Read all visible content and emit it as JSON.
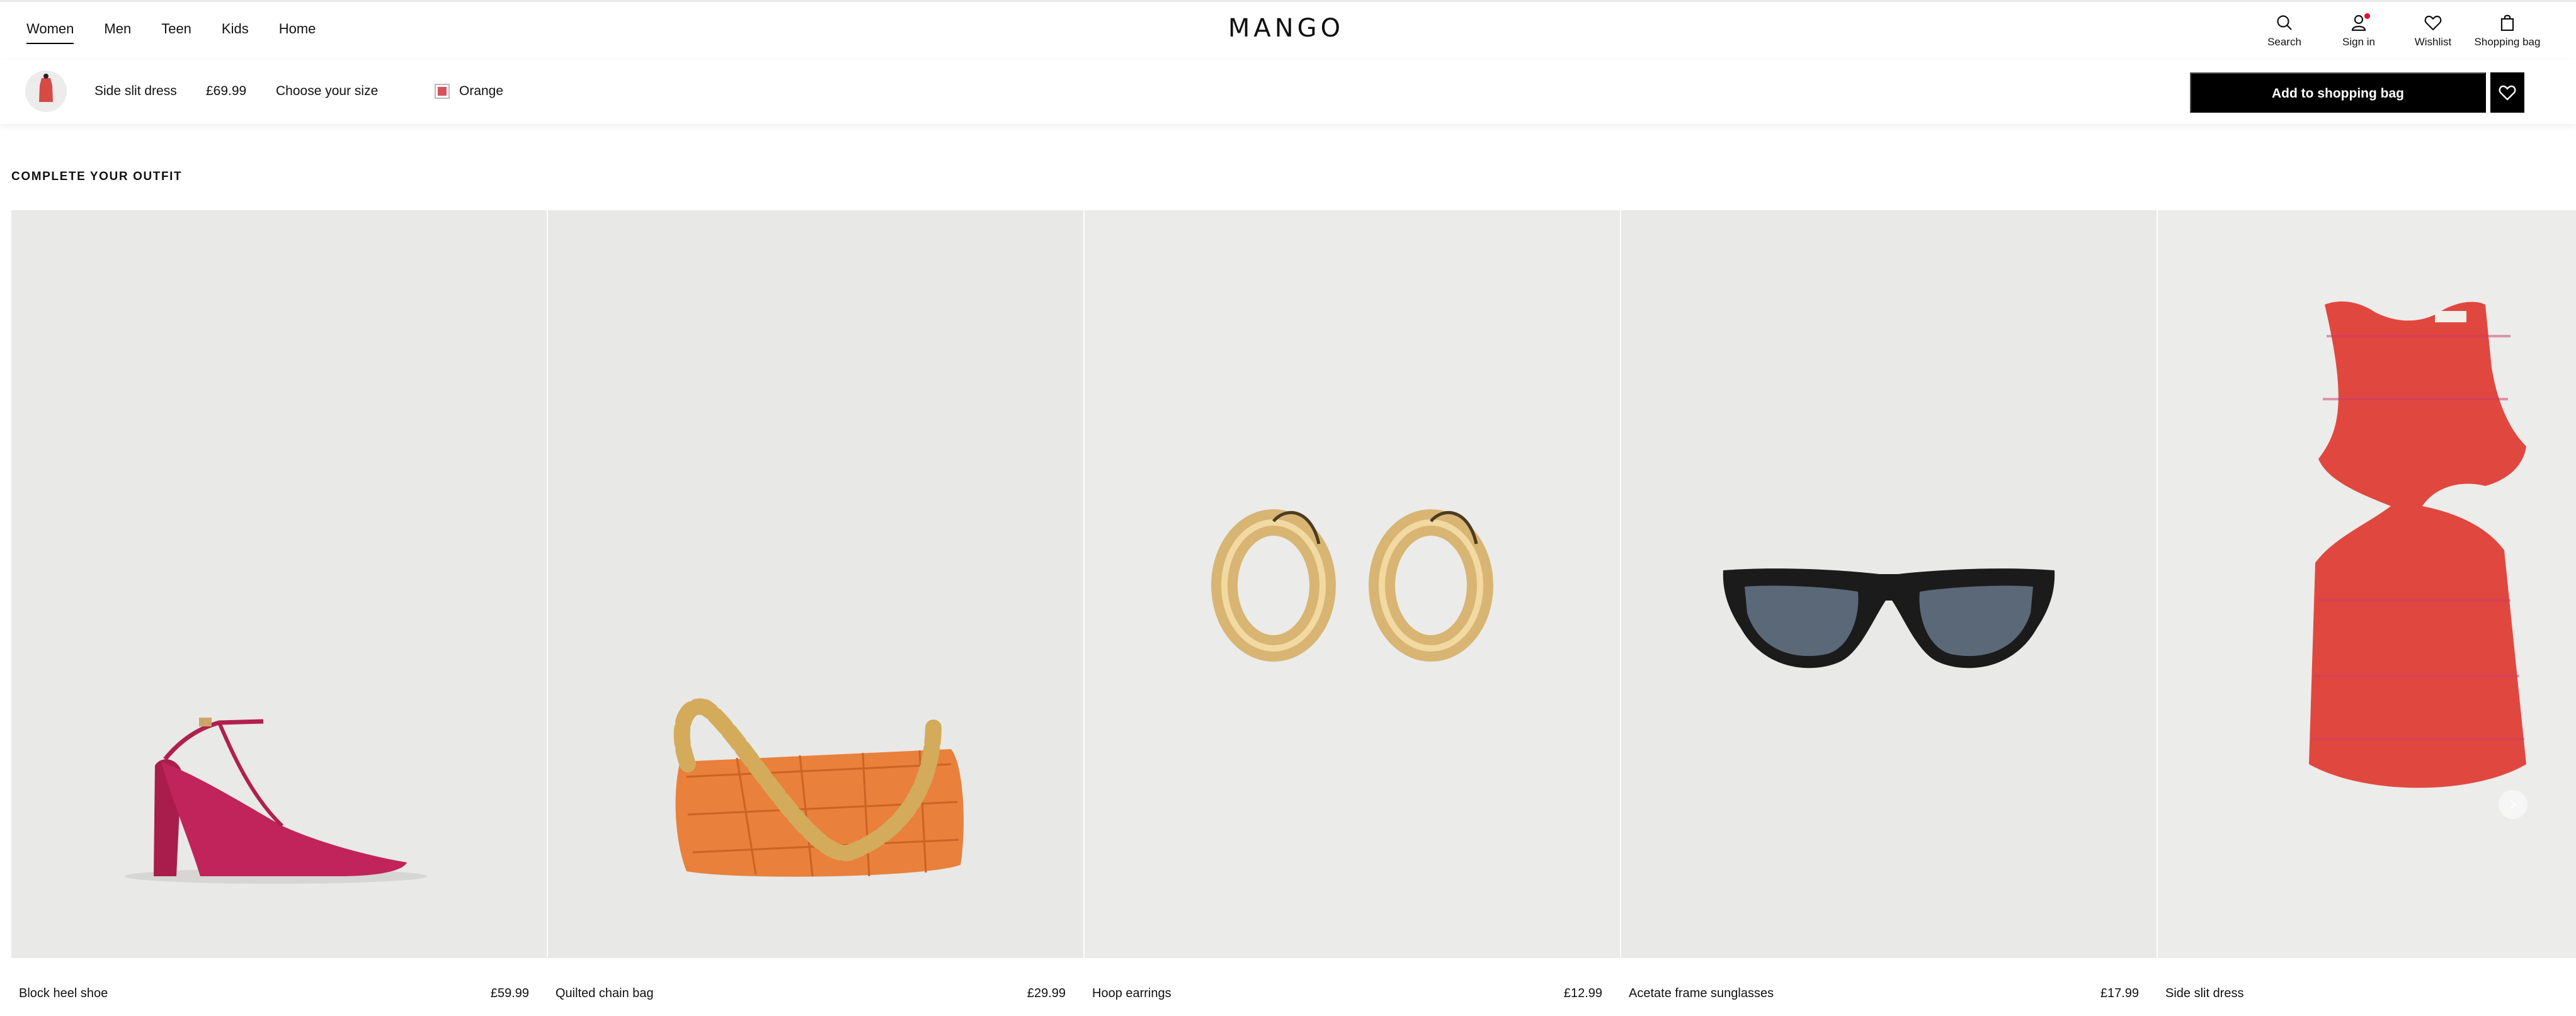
{
  "nav": {
    "items": [
      {
        "label": "Women",
        "active": true
      },
      {
        "label": "Men",
        "active": false
      },
      {
        "label": "Teen",
        "active": false
      },
      {
        "label": "Kids",
        "active": false
      },
      {
        "label": "Home",
        "active": false
      }
    ]
  },
  "brand": {
    "logo_text": "MANGO"
  },
  "tools": {
    "search": {
      "label": "Search",
      "icon": "search-icon"
    },
    "signin": {
      "label": "Sign in",
      "icon": "user-icon",
      "has_notification": true,
      "notification_color": "#e3112a"
    },
    "wishlist": {
      "label": "Wishlist",
      "icon": "heart-icon"
    },
    "bag": {
      "label": "Shopping bag",
      "icon": "bag-icon"
    }
  },
  "product_bar": {
    "product_name": "Side slit dress",
    "price": "£69.99",
    "size_prompt": "Choose your size",
    "color_name": "Orange",
    "color_swatch": "#d6535d",
    "add_button_label": "Add to shopping bag"
  },
  "outfit": {
    "title": "COMPLETE YOUR OUTFIT",
    "items": [
      {
        "name": "Block heel shoe",
        "price": "£59.99"
      },
      {
        "name": "Quilted chain bag",
        "price": "£29.99"
      },
      {
        "name": "Hoop earrings",
        "price": "£12.99"
      },
      {
        "name": "Acetate frame sunglasses",
        "price": "£17.99"
      },
      {
        "name": "Side slit dress",
        "price": ""
      }
    ]
  },
  "colors": {
    "accent": "#000000",
    "image_background": "#e9e9e7",
    "shoe": "#c0245a",
    "bag": "#e9803c",
    "gold": "#d8b572",
    "dress": "#e0483f"
  }
}
